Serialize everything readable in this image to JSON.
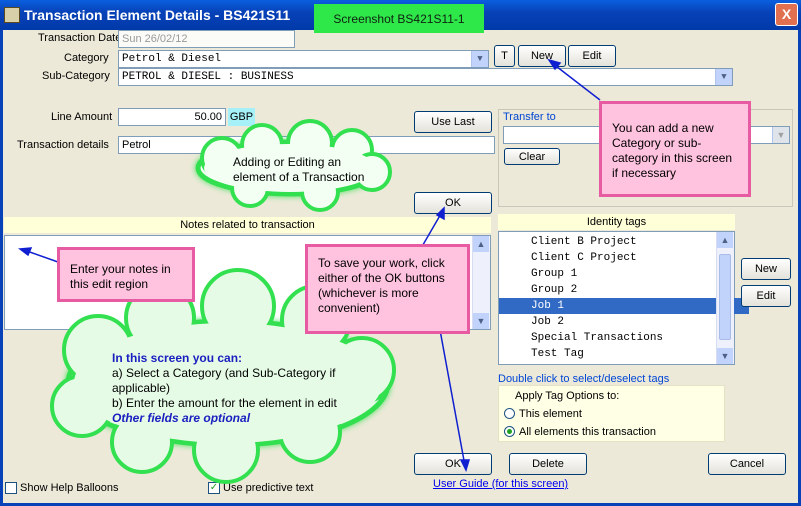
{
  "window": {
    "title": "Transaction Element Details - BS421S11",
    "screenshot_label": "Screenshot BS421S11-1",
    "close_glyph": "X"
  },
  "form": {
    "transaction_date_label": "Transaction Date",
    "transaction_date_value": "Sun 26/02/12",
    "category_label": "Category",
    "category_value": "Petrol & Diesel",
    "subcategory_label": "Sub-Category",
    "subcategory_value": "PETROL & DIESEL : BUSINESS",
    "t_button": "T",
    "new_button": "New",
    "edit_button": "Edit",
    "line_amount_label": "Line Amount",
    "line_amount_value": "50.00",
    "currency": "GBP",
    "use_last_button": "Use Last",
    "transaction_details_label": "Transaction details",
    "transaction_details_value": "Petrol",
    "ok_button": "OK"
  },
  "transfer": {
    "label": "Transfer to",
    "value": "",
    "clear_button": "Clear"
  },
  "notes": {
    "header": "Notes related to transaction",
    "value": ""
  },
  "tags": {
    "header": "Identity tags",
    "items": [
      {
        "label": "Client B Project"
      },
      {
        "label": "Client C Project"
      },
      {
        "label": "Group 1"
      },
      {
        "label": "Group 2"
      },
      {
        "label": "Job 1"
      },
      {
        "label": "Job 2"
      },
      {
        "label": "Special Transactions"
      },
      {
        "label": "Test Tag"
      }
    ],
    "selected_index": 4,
    "new_button": "New",
    "edit_button": "Edit",
    "hint": "Double click to select/deselect tags",
    "apply_label": "Apply Tag Options to:",
    "option_this": "This element",
    "option_all": "All elements this transaction"
  },
  "bottom": {
    "ok_button": "OK",
    "delete_button": "Delete",
    "cancel_button": "Cancel",
    "show_help_label": "Show Help Balloons",
    "predictive_label": "Use predictive text",
    "predictive_check": "✓",
    "user_guide_link": "User Guide (for this screen)"
  },
  "callouts": {
    "add_new": "You can add a new Category or sub-category in this screen if necessary",
    "adding_editing": "Adding or Editing an element of a Transaction",
    "notes": "Enter your notes in this edit region",
    "save": "To save your work, click either of the OK buttons (whichever is more convenient)",
    "cloud_title": "In this screen you can:",
    "cloud_line_a": "a) Select a Category (and Sub-Category if applicable)",
    "cloud_line_b": "b) Enter the amount for the element in edit",
    "cloud_line_c": "Other fields are optional"
  },
  "colors": {
    "title_bar": "#0842b8",
    "window_bg": "#ece9d8",
    "callout_pink": "#ffc2df",
    "callout_border": "#e75ba3",
    "cloud_green": "#2ee84a",
    "selection": "#316ac5",
    "arrow": "#1020d0"
  }
}
